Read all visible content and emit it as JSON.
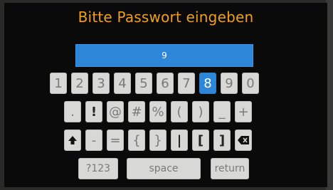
{
  "title": "Bitte Passwort eingeben",
  "password_field": {
    "value": "9"
  },
  "keyboard": {
    "row1": [
      "1",
      "2",
      "3",
      "4",
      "5",
      "6",
      "7",
      "8",
      "9",
      "0"
    ],
    "row2": [
      ".",
      "!",
      "@",
      "#",
      "%",
      "(",
      ")",
      "_",
      "+"
    ],
    "row3": [
      "shift-icon",
      "-",
      "=",
      "{",
      "}",
      "|",
      "[",
      "]",
      "backspace-icon"
    ],
    "row4": {
      "mode_label": "?123",
      "space_label": "space",
      "return_label": "return"
    },
    "active_key": "8"
  },
  "colors": {
    "accent_blue": "#2e86d8",
    "title_orange": "#f0a018"
  }
}
